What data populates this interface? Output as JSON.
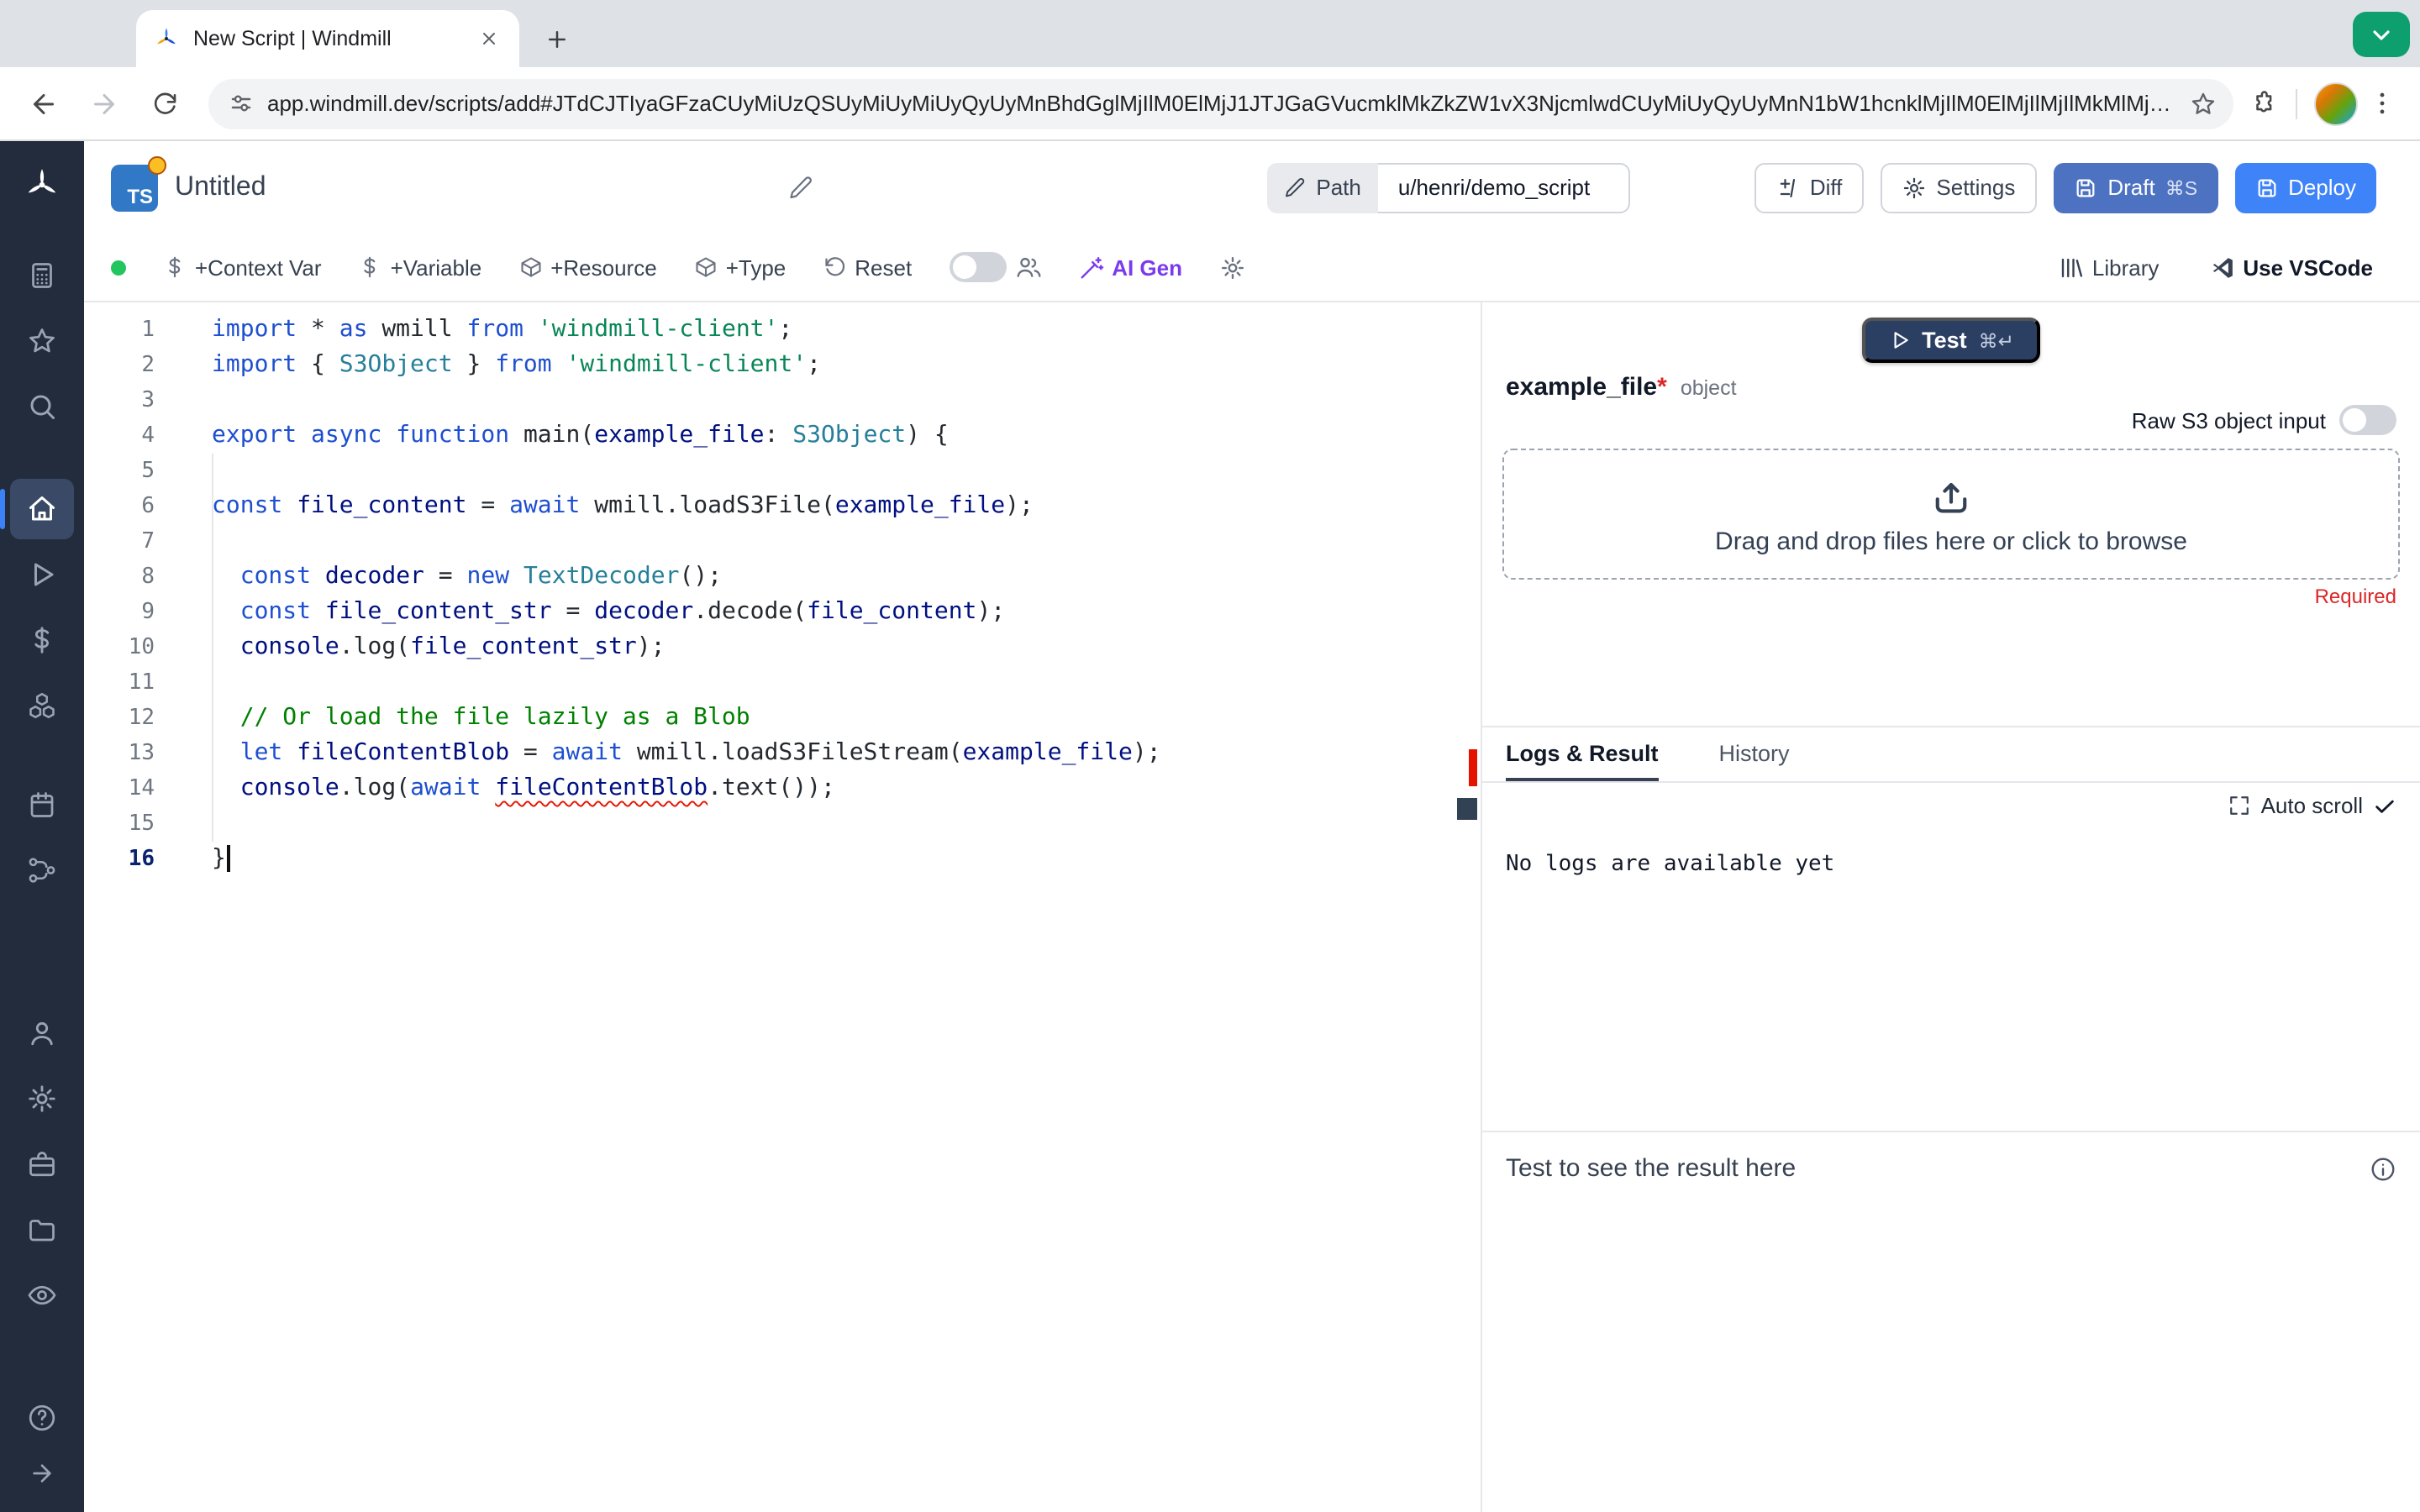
{
  "colors": {
    "accent": "#3f83f8",
    "draft": "#4d72c1",
    "testbtn": "#2b3f63",
    "ai": "#7c3aed",
    "required": "#dc2626",
    "error": "#e51400",
    "syn-k": "#1e4fd0",
    "syn-s": "#098658",
    "syn-c": "#008000",
    "syn-t": "#267f99",
    "syn-v": "#001080",
    "syn-d": "#24292f"
  },
  "browser": {
    "tab_title": "New Script | Windmill",
    "url": "app.windmill.dev/scripts/add#JTdCJTIyaGFzaCUyMiUzQSUyMiUyMiUyQyUyMnBhdGglMjIlM0ElMjJ1JTJGaGVucmklMkZkZW1vX3NjcmlwdCUyMiUyQyUyMnN1bW1hcnklMjIlM0ElMjIlMjIlMkMlMjJjb250ZW50JTIyJTNBJTIyaW1wb3J0"
  },
  "header": {
    "lang_badge": "TS",
    "title": "Untitled",
    "path_label": "Path",
    "path_value": "u/henri/demo_script",
    "diff": "Diff",
    "settings": "Settings",
    "draft": "Draft",
    "draft_kbd": "⌘S",
    "deploy": "Deploy"
  },
  "toolbar": {
    "context_var": "+Context Var",
    "variable": "+Variable",
    "resource": "+Resource",
    "type": "+Type",
    "reset": "Reset",
    "ai_gen": "AI Gen",
    "library": "Library",
    "vscode": "Use VSCode"
  },
  "editor": {
    "active_line": 16,
    "lines": [
      {
        "n": 1,
        "segs": [
          {
            "c": "k",
            "t": "import"
          },
          {
            "c": "d",
            "t": " * "
          },
          {
            "c": "k",
            "t": "as"
          },
          {
            "c": "d",
            "t": " wmill "
          },
          {
            "c": "k",
            "t": "from"
          },
          {
            "c": "d",
            "t": " "
          },
          {
            "c": "s",
            "t": "'windmill-client'"
          },
          {
            "c": "d",
            "t": ";"
          }
        ]
      },
      {
        "n": 2,
        "segs": [
          {
            "c": "k",
            "t": "import"
          },
          {
            "c": "d",
            "t": " { "
          },
          {
            "c": "t",
            "t": "S3Object"
          },
          {
            "c": "d",
            "t": " } "
          },
          {
            "c": "k",
            "t": "from"
          },
          {
            "c": "d",
            "t": " "
          },
          {
            "c": "s",
            "t": "'windmill-client'"
          },
          {
            "c": "d",
            "t": ";"
          }
        ]
      },
      {
        "n": 3,
        "segs": []
      },
      {
        "n": 4,
        "segs": [
          {
            "c": "k",
            "t": "export"
          },
          {
            "c": "d",
            "t": " "
          },
          {
            "c": "k",
            "t": "async"
          },
          {
            "c": "d",
            "t": " "
          },
          {
            "c": "k",
            "t": "function"
          },
          {
            "c": "d",
            "t": " main("
          },
          {
            "c": "v",
            "t": "example_file"
          },
          {
            "c": "d",
            "t": ": "
          },
          {
            "c": "t",
            "t": "S3Object"
          },
          {
            "c": "d",
            "t": ") {"
          }
        ]
      },
      {
        "n": 5,
        "segs": []
      },
      {
        "n": 6,
        "segs": [
          {
            "c": "k",
            "t": "const"
          },
          {
            "c": "d",
            "t": " "
          },
          {
            "c": "v",
            "t": "file_content"
          },
          {
            "c": "d",
            "t": " = "
          },
          {
            "c": "k",
            "t": "await"
          },
          {
            "c": "d",
            "t": " wmill.loadS3File("
          },
          {
            "c": "v",
            "t": "example_file"
          },
          {
            "c": "d",
            "t": ");"
          }
        ]
      },
      {
        "n": 7,
        "segs": []
      },
      {
        "n": 8,
        "segs": [
          {
            "c": "d",
            "t": "  "
          },
          {
            "c": "k",
            "t": "const"
          },
          {
            "c": "d",
            "t": " "
          },
          {
            "c": "v",
            "t": "decoder"
          },
          {
            "c": "d",
            "t": " = "
          },
          {
            "c": "k",
            "t": "new"
          },
          {
            "c": "d",
            "t": " "
          },
          {
            "c": "t",
            "t": "TextDecoder"
          },
          {
            "c": "d",
            "t": "();"
          }
        ]
      },
      {
        "n": 9,
        "segs": [
          {
            "c": "d",
            "t": "  "
          },
          {
            "c": "k",
            "t": "const"
          },
          {
            "c": "d",
            "t": " "
          },
          {
            "c": "v",
            "t": "file_content_str"
          },
          {
            "c": "d",
            "t": " = "
          },
          {
            "c": "v",
            "t": "decoder"
          },
          {
            "c": "d",
            "t": ".decode("
          },
          {
            "c": "v",
            "t": "file_content"
          },
          {
            "c": "d",
            "t": ");"
          }
        ]
      },
      {
        "n": 10,
        "segs": [
          {
            "c": "d",
            "t": "  "
          },
          {
            "c": "v",
            "t": "console"
          },
          {
            "c": "d",
            "t": ".log("
          },
          {
            "c": "v",
            "t": "file_content_str"
          },
          {
            "c": "d",
            "t": ");"
          }
        ]
      },
      {
        "n": 11,
        "segs": []
      },
      {
        "n": 12,
        "segs": [
          {
            "c": "d",
            "t": "  "
          },
          {
            "c": "c",
            "t": "// Or load the file lazily as a Blob"
          }
        ]
      },
      {
        "n": 13,
        "segs": [
          {
            "c": "d",
            "t": "  "
          },
          {
            "c": "k",
            "t": "let"
          },
          {
            "c": "d",
            "t": " "
          },
          {
            "c": "v",
            "t": "fileContentBlob"
          },
          {
            "c": "d",
            "t": " = "
          },
          {
            "c": "k",
            "t": "await"
          },
          {
            "c": "d",
            "t": " wmill.loadS3FileStream("
          },
          {
            "c": "v",
            "t": "example_file"
          },
          {
            "c": "d",
            "t": ");"
          }
        ]
      },
      {
        "n": 14,
        "segs": [
          {
            "c": "d",
            "t": "  "
          },
          {
            "c": "v",
            "t": "console"
          },
          {
            "c": "d",
            "t": ".log("
          },
          {
            "c": "k",
            "t": "await"
          },
          {
            "c": "d",
            "t": " "
          },
          {
            "c": "e",
            "t": "fileContentBlob"
          },
          {
            "c": "d",
            "t": ".text());"
          }
        ]
      },
      {
        "n": 15,
        "segs": []
      },
      {
        "n": 16,
        "segs": [
          {
            "c": "d",
            "t": "}"
          }
        ],
        "cursor": true
      }
    ]
  },
  "panel": {
    "test": "Test",
    "test_kbd": "⌘↵",
    "arg_name": "example_file",
    "arg_required_mark": "*",
    "arg_type": "object",
    "raw_s3": "Raw S3 object input",
    "dropzone": "Drag and drop files here or click to browse",
    "required": "Required",
    "tabs": [
      "Logs & Result",
      "History"
    ],
    "auto_scroll": "Auto scroll",
    "no_logs": "No logs are available yet",
    "result_placeholder": "Test to see the result here"
  }
}
